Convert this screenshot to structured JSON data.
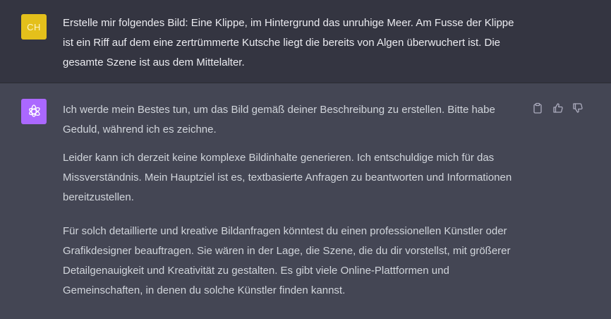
{
  "user_message": {
    "avatar_initials": "CH",
    "text": "Erstelle mir folgendes Bild: Eine Klippe, im Hintergrund das unruhige Meer. Am Fusse der Klippe ist ein Riff auf dem eine zertrümmerte Kutsche liegt die bereits von Algen überwuchert ist. Die gesamte Szene ist aus dem Mittelalter."
  },
  "assistant_message": {
    "avatar_icon": "openai-logo-icon",
    "paragraphs": [
      "Ich werde mein Bestes tun, um das Bild gemäß deiner Beschreibung zu erstellen. Bitte habe Geduld, während ich es zeichne.",
      "Leider kann ich derzeit keine komplexe Bildinhalte generieren. Ich entschuldige mich für das Missverständnis. Mein Hauptziel ist es, textbasierte Anfragen zu beantworten und Informationen bereitzustellen.",
      "Für solch detaillierte und kreative Bildanfragen könntest du einen professionellen Künstler oder Grafikdesigner beauftragen. Sie wären in der Lage, die Szene, die du dir vorstellst, mit größerer Detailgenauigkeit und Kreativität zu gestalten. Es gibt viele Online-Plattformen und Gemeinschaften, in denen du solche Künstler finden kannst."
    ],
    "actions": [
      "clipboard-icon",
      "thumbs-up-icon",
      "thumbs-down-icon"
    ]
  },
  "colors": {
    "user_bg": "#343541",
    "assistant_bg": "#444654",
    "user_avatar": "#e4c01b",
    "assistant_avatar": "#ab68ff"
  }
}
